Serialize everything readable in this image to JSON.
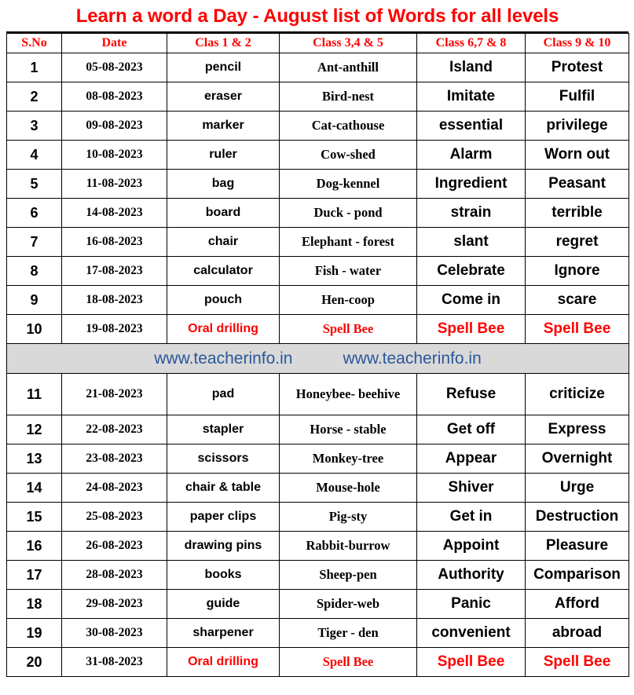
{
  "title": "Learn a word a Day - August list of Words for all levels",
  "colors": {
    "title_red": "#fe0000",
    "header_red": "#fe0000",
    "highlight_red": "#fe0000",
    "watermark_blue": "#2b579a",
    "watermark_band": "#d9d9d9",
    "text_black": "#000000",
    "border": "#000000"
  },
  "table": {
    "headers": [
      "S.No",
      "Date",
      "Clas 1 & 2",
      "Class 3,4 & 5",
      "Class 6,7 & 8",
      "Class 9 & 10"
    ],
    "rows": [
      {
        "sno": "1",
        "date": "05-08-2023",
        "c12": "pencil",
        "c345": "Ant-anthill",
        "c678": "Island",
        "c910": "Protest",
        "red": false
      },
      {
        "sno": "2",
        "date": "08-08-2023",
        "c12": "eraser",
        "c345": "Bird-nest",
        "c678": "Imitate",
        "c910": "Fulfil",
        "red": false
      },
      {
        "sno": "3",
        "date": "09-08-2023",
        "c12": "marker",
        "c345": "Cat-cathouse",
        "c678": "essential",
        "c910": "privilege",
        "red": false
      },
      {
        "sno": "4",
        "date": "10-08-2023",
        "c12": "ruler",
        "c345": "Cow-shed",
        "c678": "Alarm",
        "c910": "Worn  out",
        "red": false
      },
      {
        "sno": "5",
        "date": "11-08-2023",
        "c12": "bag",
        "c345": "Dog-kennel",
        "c678": "Ingredient",
        "c910": "Peasant",
        "red": false
      },
      {
        "sno": "6",
        "date": "14-08-2023",
        "c12": "board",
        "c345": "Duck - pond",
        "c678": "strain",
        "c910": "terrible",
        "red": false
      },
      {
        "sno": "7",
        "date": "16-08-2023",
        "c12": "chair",
        "c345": "Elephant  - forest",
        "c678": "slant",
        "c910": "regret",
        "red": false
      },
      {
        "sno": "8",
        "date": "17-08-2023",
        "c12": "calculator",
        "c345": "Fish - water",
        "c678": "Celebrate",
        "c910": "Ignore",
        "red": false
      },
      {
        "sno": "9",
        "date": "18-08-2023",
        "c12": "pouch",
        "c345": "Hen-coop",
        "c678": "Come in",
        "c910": "scare",
        "red": false
      },
      {
        "sno": "10",
        "date": "19-08-2023",
        "c12": "Oral drilling",
        "c345": "Spell Bee",
        "c678": "Spell Bee",
        "c910": "Spell Bee",
        "red": true
      },
      {
        "sno": "11",
        "date": "21-08-2023",
        "c12": "pad",
        "c345": "Honeybee-  beehive",
        "c678": "Refuse",
        "c910": "criticize",
        "red": false
      },
      {
        "sno": "12",
        "date": "22-08-2023",
        "c12": "stapler",
        "c345": "Horse - stable",
        "c678": "Get off",
        "c910": "Express",
        "red": false
      },
      {
        "sno": "13",
        "date": "23-08-2023",
        "c12": "scissors",
        "c345": "Monkey-tree",
        "c678": "Appear",
        "c910": "Overnight",
        "red": false
      },
      {
        "sno": "14",
        "date": "24-08-2023",
        "c12": "chair & table",
        "c345": "Mouse-hole",
        "c678": "Shiver",
        "c910": "Urge",
        "red": false
      },
      {
        "sno": "15",
        "date": "25-08-2023",
        "c12": "paper clips",
        "c345": "Pig-sty",
        "c678": "Get in",
        "c910": "Destruction",
        "red": false
      },
      {
        "sno": "16",
        "date": "26-08-2023",
        "c12": "drawing pins",
        "c345": "Rabbit-burrow",
        "c678": "Appoint",
        "c910": "Pleasure",
        "red": false
      },
      {
        "sno": "17",
        "date": "28-08-2023",
        "c12": "books",
        "c345": "Sheep-pen",
        "c678": "Authority",
        "c910": "Comparison",
        "red": false
      },
      {
        "sno": "18",
        "date": "29-08-2023",
        "c12": "guide",
        "c345": "Spider-web",
        "c678": "Panic",
        "c910": "Afford",
        "red": false
      },
      {
        "sno": "19",
        "date": "30-08-2023",
        "c12": "sharpener",
        "c345": "Tiger - den",
        "c678": "convenient",
        "c910": "abroad",
        "red": false
      },
      {
        "sno": "20",
        "date": "31-08-2023",
        "c12": "Oral drilling",
        "c345": "Spell Bee",
        "c678": "Spell Bee",
        "c910": "Spell Bee",
        "red": true
      }
    ]
  },
  "watermark": {
    "left_text": "www.teacherinfo.in",
    "right_text": "www.teacherinfo.in",
    "after_row_index": 9
  }
}
